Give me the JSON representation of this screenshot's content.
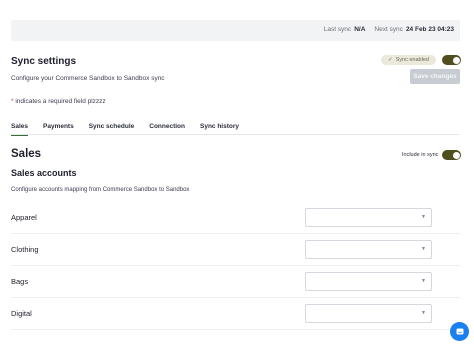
{
  "header": {
    "last_sync_label": "Last sync",
    "last_sync_value": "N/A",
    "next_sync_label": "Next sync",
    "next_sync_value": "24 Feb 23 04:23"
  },
  "settings": {
    "title": "Sync settings",
    "subtitle": "Configure your Commerce Sandbox to Sandbox sync",
    "required_note": "indicates a required field plzzzz",
    "required_star": "*",
    "sync_enabled_label": "Sync enabled",
    "save_button": "Save changes"
  },
  "tabs": [
    {
      "label": "Sales",
      "active": true
    },
    {
      "label": "Payments",
      "active": false
    },
    {
      "label": "Sync schedule",
      "active": false
    },
    {
      "label": "Connection",
      "active": false
    },
    {
      "label": "Sync history",
      "active": false
    }
  ],
  "sales": {
    "title": "Sales",
    "include_label": "Include in sync",
    "accounts_title": "Sales accounts",
    "accounts_subtitle": "Configure accounts mapping from Commerce Sandbox to Sandbox",
    "rows": [
      {
        "label": "Apparel",
        "value": ""
      },
      {
        "label": "Clothing",
        "value": ""
      },
      {
        "label": "Bags",
        "value": ""
      },
      {
        "label": "Digital",
        "value": ""
      }
    ]
  },
  "icons": {
    "check": "check-icon",
    "chevron": "chevron-down-icon",
    "chat": "chat-icon"
  },
  "colors": {
    "toggle_on": "#4f4e1e",
    "save_disabled": "#c7cbd2",
    "chat_button": "#1b7ff0",
    "active_tab": "#2f6f3a"
  }
}
